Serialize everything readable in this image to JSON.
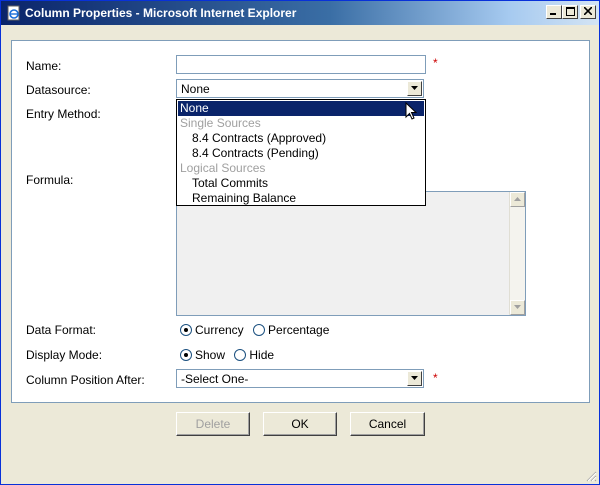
{
  "window": {
    "title": "Column Properties - Microsoft Internet Explorer",
    "title_color": "#0a246a"
  },
  "form": {
    "name_label": "Name:",
    "name_value": "",
    "required_mark": "*",
    "datasource_label": "Datasource:",
    "datasource_value": "None",
    "datasource_options": [
      {
        "label": "None",
        "type": "option",
        "selected": true
      },
      {
        "label": "Single Sources",
        "type": "group"
      },
      {
        "label": "8.4 Contracts (Approved)",
        "type": "child"
      },
      {
        "label": "8.4 Contracts (Pending)",
        "type": "child"
      },
      {
        "label": "Logical Sources",
        "type": "group"
      },
      {
        "label": "Total Commits",
        "type": "child"
      },
      {
        "label": "Remaining Balance",
        "type": "child"
      }
    ],
    "entry_method_label": "Entry Method:",
    "formula_label": "Formula:",
    "data_format_label": "Data Format:",
    "data_format_options": [
      {
        "label": "Currency",
        "checked": true
      },
      {
        "label": "Percentage",
        "checked": false
      }
    ],
    "display_mode_label": "Display Mode:",
    "display_mode_options": [
      {
        "label": "Show",
        "checked": true
      },
      {
        "label": "Hide",
        "checked": false
      }
    ],
    "column_position_label": "Column Position After:",
    "column_position_value": "-Select One-"
  },
  "buttons": {
    "delete": "Delete",
    "ok": "OK",
    "cancel": "Cancel"
  },
  "icons": {
    "window": "ie-page-icon",
    "minimize": "minimize-icon",
    "maximize": "maximize-icon",
    "close": "close-icon",
    "cursor": "mouse-pointer-icon"
  },
  "colors": {
    "selection": "#0a246a",
    "required": "#cc0000",
    "group_text": "#a0a0a0"
  }
}
